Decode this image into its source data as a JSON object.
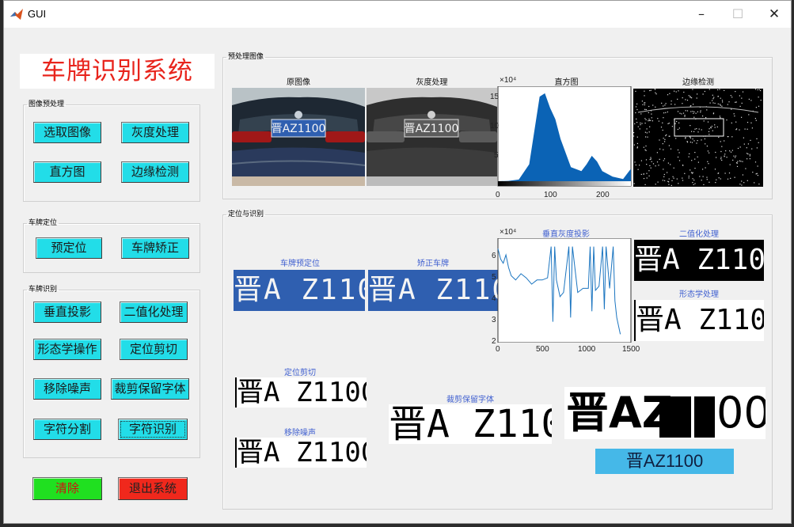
{
  "window": {
    "title": "GUI",
    "minimize": "–",
    "maximize": "☐",
    "close": "✕"
  },
  "app_title": "车牌识别系统",
  "panels": {
    "preprocess": {
      "label": "图像预处理",
      "buttons": [
        "选取图像",
        "灰度处理",
        "直方图",
        "边缘检测"
      ]
    },
    "locate": {
      "label": "车牌定位",
      "buttons": [
        "预定位",
        "车牌矫正"
      ]
    },
    "recognize": {
      "label": "车牌识别",
      "buttons": [
        "垂直投影",
        "二值化处理",
        "形态学操作",
        "定位剪切",
        "移除噪声",
        "裁剪保留字体",
        "字符分割",
        "字符识别"
      ]
    },
    "clear_button": "清除",
    "exit_button": "退出系统",
    "preview_group": "预处理图像",
    "locrec_group": "定位与识别"
  },
  "plots": {
    "original": "原图像",
    "gray": "灰度处理",
    "histogram": "直方图",
    "edge": "边缘检测",
    "hist_exp": "×10⁴",
    "hist_y_ticks": [
      "15",
      "10",
      "5",
      "0"
    ],
    "hist_x_ticks": [
      "0",
      "100",
      "200"
    ],
    "prelocate": "车牌预定位",
    "corrected": "矫正车牌",
    "vproj": "垂直灰度投影",
    "vproj_exp": "×10⁴",
    "vproj_y_ticks": [
      "6",
      "5",
      "4",
      "3",
      "2"
    ],
    "vproj_x_ticks": [
      "0",
      "500",
      "1000",
      "1500"
    ],
    "binarize": "二值化处理",
    "morph": "形态学处理",
    "crop": "定位剪切",
    "denoise": "移除噪声",
    "keep_font": "裁剪保留字体"
  },
  "plate_text": "晋AZ1100",
  "plate_text_spaced": "晋A Z1100",
  "plate_text_split_a": "晋AZ",
  "plate_text_split_b": "00",
  "result": "晋AZ1100",
  "colors": {
    "title_red": "#e8241c",
    "button_cyan": "#22dde8",
    "clear_green": "#20e020",
    "exit_red": "#f0281c",
    "result_blue": "#45b8e8",
    "hist_fill": "#0b63b5",
    "proj_line": "#1b75c0"
  },
  "chart_data": [
    {
      "type": "area",
      "x": [
        0,
        20,
        40,
        60,
        70,
        80,
        90,
        100,
        110,
        120,
        140,
        160,
        170,
        180,
        190,
        200,
        220,
        240,
        255
      ],
      "y": [
        0,
        0.05,
        0.3,
        3,
        9,
        15,
        15.6,
        13,
        11,
        7.5,
        2.5,
        1.8,
        3,
        4.5,
        3.5,
        1.8,
        0.8,
        0.4,
        2.2
      ],
      "xlim": [
        0,
        255
      ],
      "ylim": [
        0,
        16
      ],
      "y_multiplier": "×10⁴"
    },
    {
      "type": "line",
      "x": [
        0,
        30,
        60,
        90,
        120,
        150,
        200,
        260,
        320,
        380,
        440,
        500,
        560,
        600,
        620,
        640,
        660,
        700,
        740,
        800,
        820,
        840,
        900,
        960,
        1020,
        1040,
        1060,
        1080,
        1100,
        1140,
        1180,
        1200,
        1220,
        1260,
        1300,
        1320,
        1340,
        1380
      ],
      "y": [
        6.5,
        6.0,
        5.8,
        6.2,
        5.6,
        5.2,
        5.0,
        5.3,
        5.1,
        4.8,
        5.0,
        5.0,
        5.1,
        6.6,
        3.0,
        6.6,
        5.0,
        4.2,
        4.4,
        6.6,
        3.2,
        6.6,
        4.4,
        4.6,
        4.6,
        6.6,
        3.5,
        6.6,
        4.5,
        4.7,
        6.6,
        3.6,
        6.6,
        4.6,
        6.6,
        4.0,
        3.2,
        2.4
      ],
      "xlim": [
        0,
        1500
      ],
      "ylim": [
        2,
        7
      ],
      "y_multiplier": "×10⁴"
    }
  ]
}
